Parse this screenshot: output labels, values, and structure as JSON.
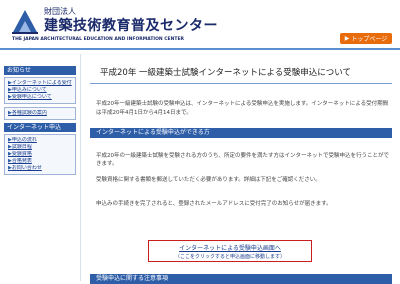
{
  "header": {
    "org_label": "財団法人",
    "org_name": "建築技術教育普及センター",
    "org_english": "THE JAPAN ARCHITECTURAL EDUCATION AND INFORMATION CENTER",
    "top_link_label": "トップページ",
    "top_link_arrow": "▶"
  },
  "sidebar": {
    "section1_head": "お知らせ",
    "section1_items": [
      "インターネットによる受付",
      "申込みについて",
      "受験申込について"
    ],
    "section2_items": [
      "各種試験の案内"
    ],
    "section3_head": "インターネット申込",
    "section3_items": [
      "申込の流れ",
      "試験日程",
      "受験資格",
      "合格発表",
      "お問い合わせ"
    ]
  },
  "main": {
    "page_title": "平成20年 一級建築士試験インターネットによる受験申込について",
    "intro": "平成20年一級建築士試験の受験申込は、インターネットによる受験申込を実施します。インターネットによる受付期間は平成20年4月1日から4月14日まで。",
    "section1_head": "インターネットによる受験申込ができる方",
    "section1_text1": "平成20年の一級建築士試験を受験される方のうち、所定の要件を満たす方はインターネットで受験申込を行うことができます。",
    "section1_text2": "受験資格に関する書類を郵送していただく必要があります。詳細は下記をご確認ください。",
    "section1_text3": "申込みの手続きを完了されると、登録されたメールアドレスに受付完了のお知らせが届きます。",
    "apply_link": "インターネットによる受験申込画面へ",
    "apply_sub": "（ここをクリックすると申込画面に移動します）",
    "section2_head": "受験申込に関する注意事項"
  }
}
